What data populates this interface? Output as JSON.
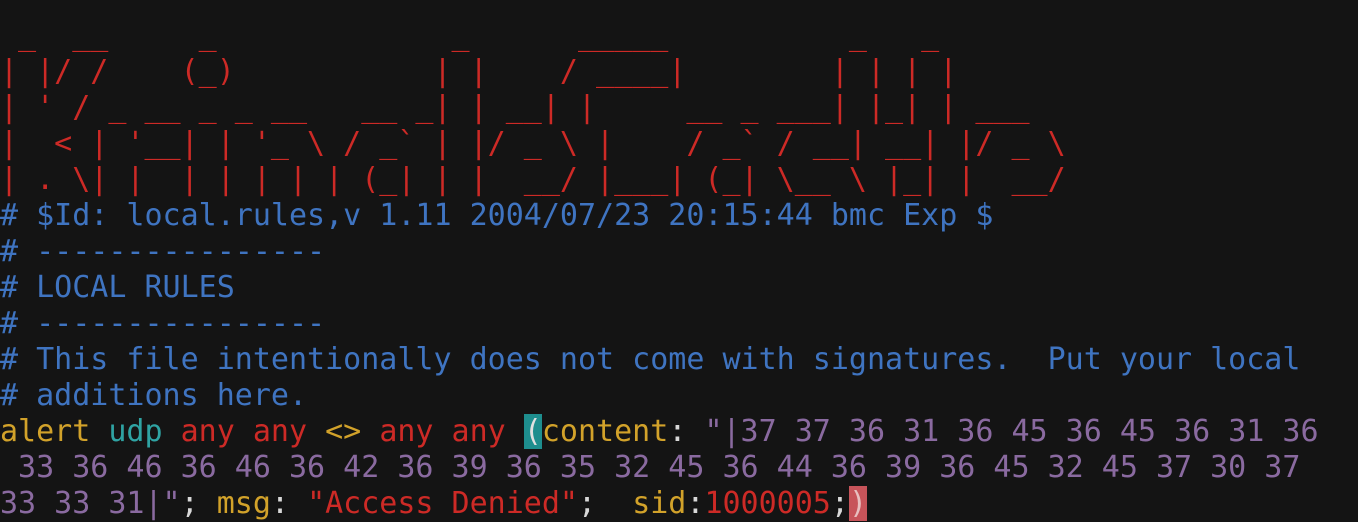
{
  "banner": {
    "lines": [
      " _  __     _             _      _____          _   _      ",
      "| |/ /    (_)           | |    / ____|        | | | |     ",
      "| ' / _ __ _ _ __   __ _| | __| |     __ _ ___| |_| | ___ ",
      "|  < | '__| | '_ \\ / _` | |/ _ \\ |    / _` / __| __| |/ _ \\",
      "| . \\| |  | | | | | (_| | |  __/ |___| (_| \\__ \\ |_| |  __/",
      "|_|\\_\\_|  |_|_| |_|\\__,_|_|\\___|\\_____\\__,_|___/\\__|_|\\___|"
    ]
  },
  "comments": [
    "# $Id: local.rules,v 1.11 2004/07/23 20:15:44 bmc Exp $",
    "# ----------------",
    "# LOCAL RULES",
    "# ----------------",
    "# This file intentionally does not come with signatures.  Put your local",
    "# additions here."
  ],
  "rule": {
    "action": "alert",
    "protocol": "udp",
    "src": "any any",
    "direction": "<>",
    "dst": "any any",
    "open_paren": "(",
    "content_key": "content",
    "content_value_line1": "\"|37 37 36 31 36 45 36 45 36 31 36",
    "content_value_line2": " 33 36 46 36 46 36 42 36 39 36 35 32 45 36 44 36 39 36 45 32 45 37 30 37",
    "content_value_line3": "33 33 31|\"",
    "msg_key": "msg",
    "msg_value": "\"Access Denied\"",
    "sid_key": "sid",
    "sid_value": "1000005",
    "close_paren": ")"
  },
  "colors": {
    "background": "#141414",
    "banner": "#cd2a26",
    "comment": "#3f74c1",
    "keyword": "#d2a22a",
    "protocol": "#2fa3a3",
    "string": "#8a6aa0"
  }
}
